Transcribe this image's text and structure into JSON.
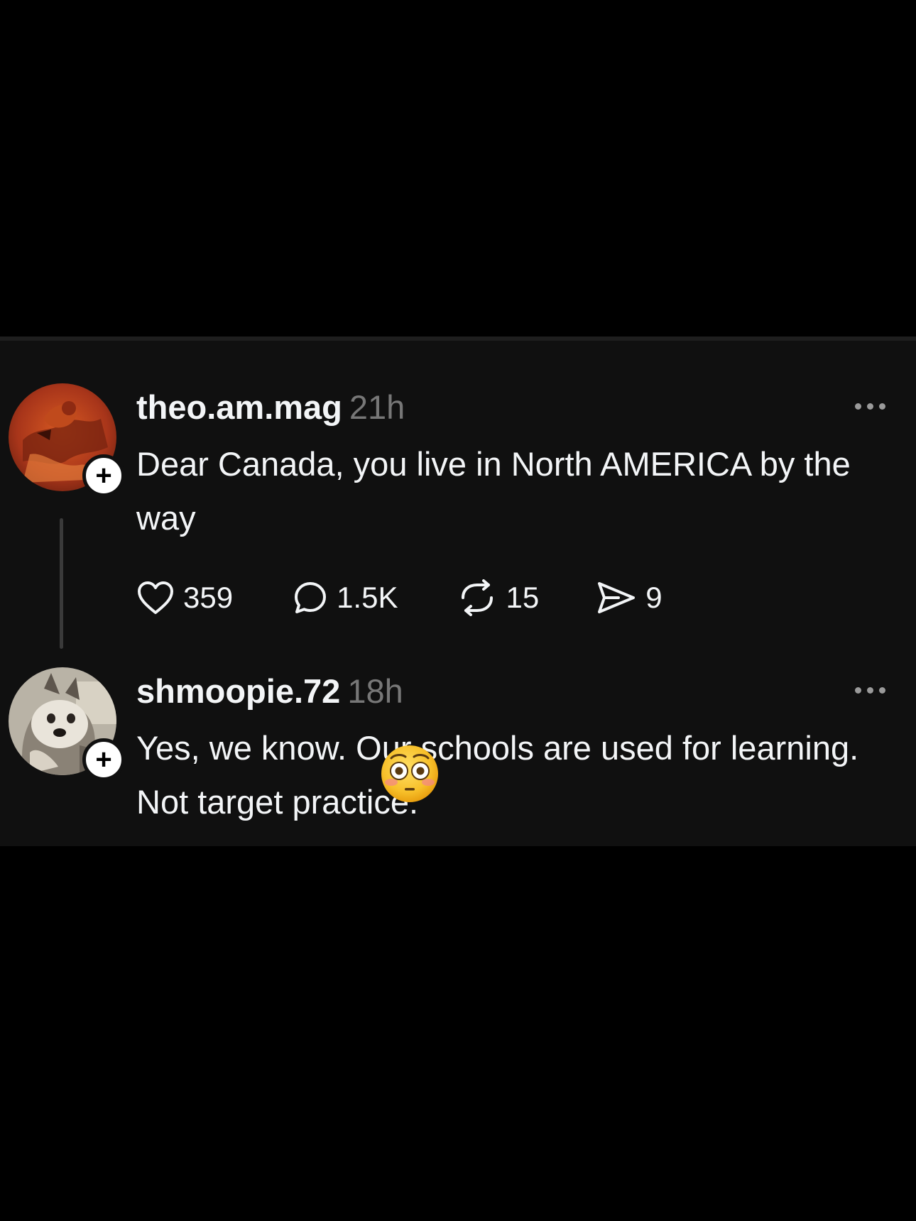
{
  "thread": [
    {
      "username": "theo.am.mag",
      "time": "21h",
      "text": "Dear Canada, you live in North AMERICA by the way",
      "actions": {
        "likes": "359",
        "replies": "1.5K",
        "reposts": "15",
        "shares": "9"
      },
      "avatar_icon": "orange-abstract-avatar",
      "follow_icon": "plus-icon",
      "follow_symbol": "+"
    },
    {
      "username": "shmoopie.72",
      "time": "18h",
      "text": "Yes, we know. Our schools are used for learning. Not target practice.",
      "avatar_icon": "husky-plush-avatar",
      "follow_icon": "plus-icon",
      "follow_symbol": "+",
      "sticker": "flushed-face-emoji"
    }
  ],
  "colors": {
    "background": "#000000",
    "panel": "#101010",
    "text": "#f3f5f7",
    "muted": "#777777",
    "thread_line": "#3a3a3a"
  }
}
